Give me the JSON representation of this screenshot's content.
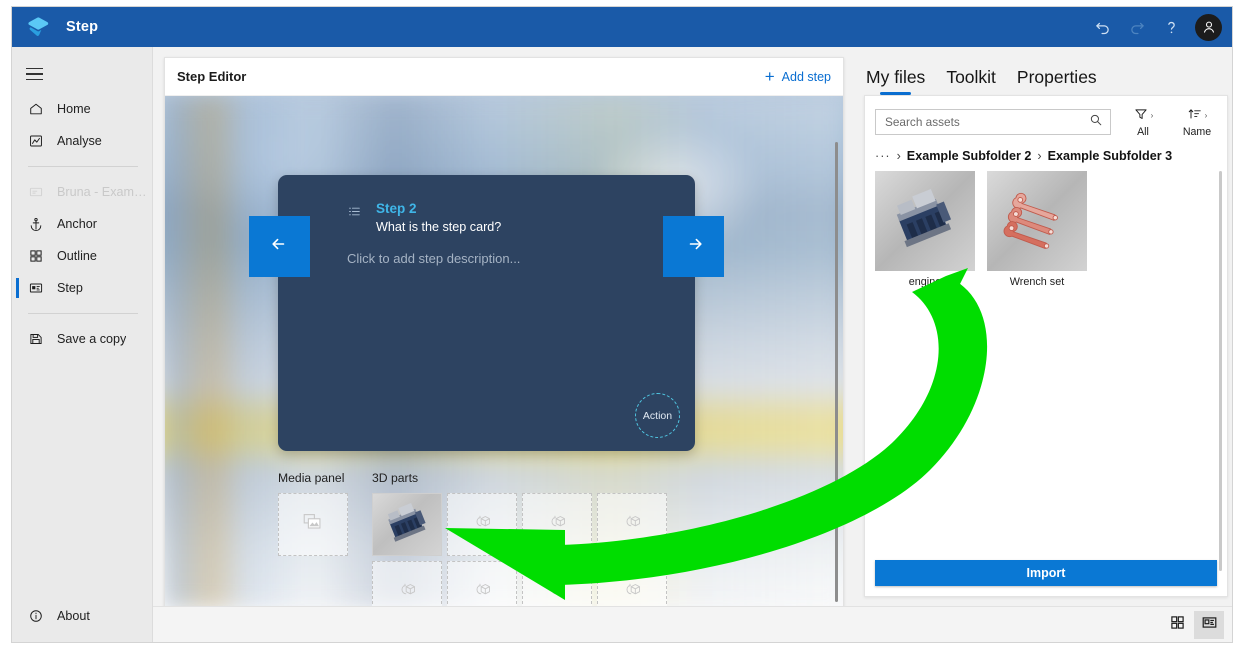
{
  "titlebar": {
    "app_title": "Step",
    "logo_icon": "step-logo-icon",
    "undo_icon": "undo-icon",
    "redo_icon": "redo-icon",
    "help_icon": "help-question-icon",
    "avatar_icon": "user-avatar-icon",
    "bg_color": "#1a5aa8"
  },
  "sidebar": {
    "menu_icon": "hamburger-menu-icon",
    "items": [
      {
        "label": "Home",
        "icon": "home-icon",
        "state": "normal"
      },
      {
        "label": "Analyse",
        "icon": "analyse-chart-icon",
        "state": "normal"
      },
      {
        "label": "Bruna - Example Gui...",
        "icon": "guide-icon",
        "state": "disabled"
      },
      {
        "label": "Anchor",
        "icon": "anchor-icon",
        "state": "normal"
      },
      {
        "label": "Outline",
        "icon": "outline-grid-icon",
        "state": "normal"
      },
      {
        "label": "Step",
        "icon": "step-card-icon",
        "state": "active"
      },
      {
        "label": "Save a copy",
        "icon": "save-disk-icon",
        "state": "normal"
      }
    ],
    "about": {
      "label": "About",
      "icon": "info-circle-icon"
    }
  },
  "editor": {
    "title": "Step Editor",
    "add_step_label": "Add step",
    "add_step_icon": "plus-icon",
    "prev_icon": "arrow-left-icon",
    "next_icon": "arrow-right-icon",
    "card": {
      "list_icon": "step-list-icon",
      "step_number": "Step 2",
      "question": "What is the step card?",
      "description_placeholder": "Click to add step description...",
      "action_label": "Action",
      "accent_color": "#3fb6e8",
      "card_color": "#2d4361"
    },
    "media_panel": {
      "label": "Media panel",
      "placeholder_icon": "media-image-icon"
    },
    "parts_panel": {
      "label": "3D parts",
      "placeholder_icon": "cube-3d-icon",
      "slots": [
        {
          "filled": true,
          "name": "engine-part-thumbnail"
        },
        {
          "filled": false,
          "name": "empty-part-slot"
        },
        {
          "filled": false,
          "name": "empty-part-slot"
        },
        {
          "filled": false,
          "name": "empty-part-slot"
        },
        {
          "filled": false,
          "name": "empty-part-slot"
        },
        {
          "filled": false,
          "name": "empty-part-slot"
        },
        {
          "filled": false,
          "name": "empty-part-slot"
        },
        {
          "filled": false,
          "name": "empty-part-slot"
        }
      ]
    }
  },
  "right_panel": {
    "tabs": [
      {
        "label": "My files",
        "active": true
      },
      {
        "label": "Toolkit",
        "active": false
      },
      {
        "label": "Properties",
        "active": false
      }
    ],
    "search": {
      "placeholder": "Search assets",
      "value": "",
      "icon": "search-icon"
    },
    "filter": {
      "label": "All",
      "icon": "filter-funnel-icon",
      "chevron": "›"
    },
    "sort": {
      "label": "Name",
      "icon": "sort-ascending-icon",
      "chevron": "›"
    },
    "breadcrumb": {
      "overflow": "···",
      "separator": "›",
      "items": [
        "Example Subfolder 2",
        "Example Subfolder 3"
      ]
    },
    "assets": [
      {
        "name": "engine",
        "thumb": "engine-3d-thumbnail"
      },
      {
        "name": "Wrench set",
        "thumb": "wrench-set-3d-thumbnail"
      }
    ],
    "import_label": "Import"
  },
  "statusbar": {
    "grid_view": {
      "icon": "grid-view-icon",
      "selected": false
    },
    "card_view": {
      "icon": "card-view-icon",
      "selected": true
    }
  },
  "annotation": {
    "arrow_color": "#00dd00",
    "description": "curved green arrow from engine asset to 3D parts grid"
  }
}
